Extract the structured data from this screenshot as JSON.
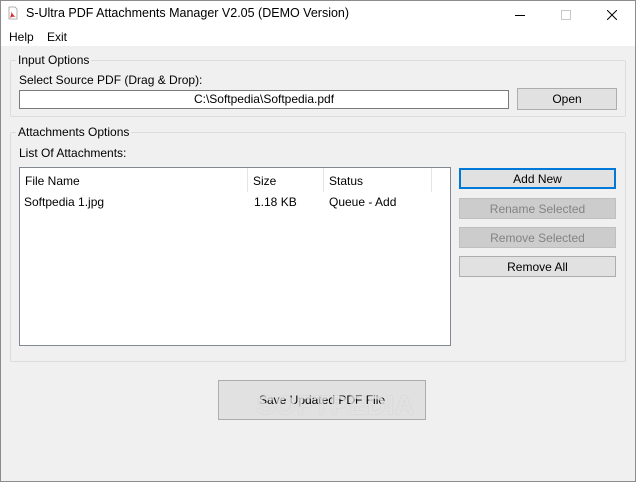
{
  "window": {
    "title": "S-Ultra PDF Attachments Manager V2.05 (DEMO Version)",
    "minimize_glyph": "—",
    "maximize_glyph": "☐",
    "close_glyph": "✕"
  },
  "menu": {
    "items": [
      "Help",
      "Exit"
    ]
  },
  "input_options": {
    "group_title": "Input Options",
    "source_label": "Select Source PDF (Drag & Drop):",
    "source_path": "C:\\Softpedia\\Softpedia.pdf",
    "open_button": "Open"
  },
  "attachments_options": {
    "group_title": "Attachments Options",
    "list_label": "List Of Attachments:",
    "columns": [
      "File Name",
      "Size",
      "Status"
    ],
    "rows": [
      {
        "file_name": "Softpedia 1.jpg",
        "size": "1.18 KB",
        "status": "Queue - Add"
      }
    ],
    "buttons": {
      "add_new": "Add New",
      "rename_selected": "Rename Selected",
      "remove_selected": "Remove Selected",
      "remove_all": "Remove All"
    }
  },
  "save_button": "Save Updated PDF File",
  "watermark": "SOFTPEDIA",
  "colors": {
    "accent": "#0078d7",
    "pdf_icon_red": "#d9262a"
  }
}
